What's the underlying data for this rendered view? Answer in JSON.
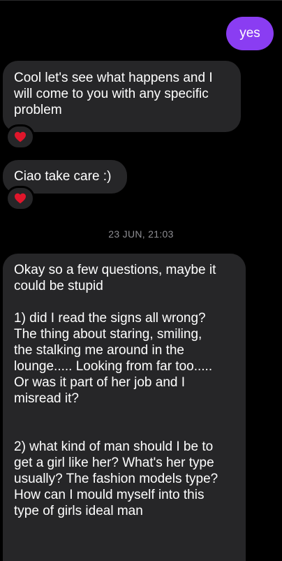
{
  "chat": {
    "messages": [
      {
        "sender": "me",
        "text": "yes"
      },
      {
        "sender": "them",
        "text": "Cool let's see what happens and I\nwill come to you with any specific\nproblem",
        "reaction": "heart"
      },
      {
        "sender": "them",
        "text": "Ciao take care :)",
        "reaction": "heart"
      },
      {
        "sender": "them",
        "text": "Okay so a few questions, maybe it\ncould be stupid\n\n1) did I read the signs all wrong?\nThe thing about staring, smiling,\nthe stalking me around in the\nlounge..... Looking from far too.....\nOr was it part of her job and I\nmisread it?\n\n\n2) what kind of man should I be to\nget a girl like her? What's her type\nusually? The fashion models type?\nHow can I mould myself into this\ntype of girls ideal man"
      }
    ],
    "timestamp": "23 JUN, 21:03"
  },
  "colors": {
    "background": "#000000",
    "incoming_bubble": "#262628",
    "outgoing_bubble": "#8a3df2",
    "reaction_heart": "#e0162b",
    "timestamp_text": "#8e8e93"
  },
  "icons": {
    "reaction": "heart-icon"
  }
}
